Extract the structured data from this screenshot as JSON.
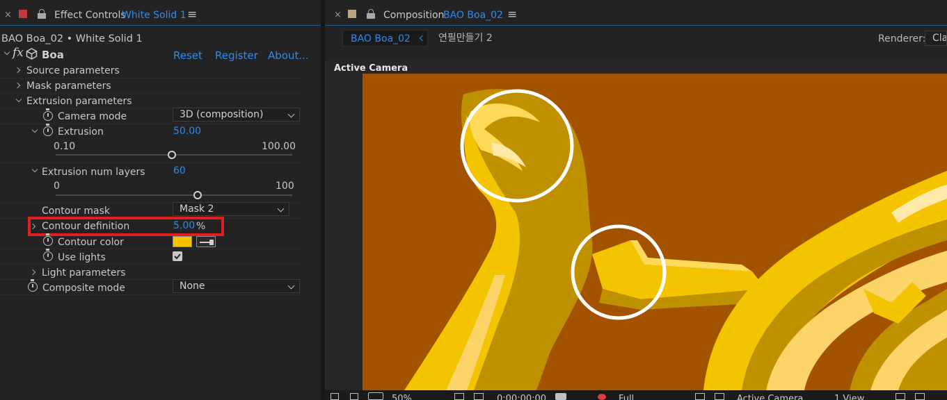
{
  "effect_controls": {
    "close_glyph": "×",
    "title": "Effect Controls",
    "layer_name": "White Solid 1",
    "menu_glyph": "≡",
    "breadcrumb": "BAO Boa_02 • White Solid 1",
    "effect": {
      "fx_label": "fx",
      "name": "Boa",
      "reset": "Reset",
      "register": "Register",
      "about": "About..."
    },
    "groups": {
      "source": "Source parameters",
      "mask": "Mask parameters",
      "extrusion": "Extrusion parameters",
      "light": "Light parameters"
    },
    "camera_mode": {
      "label": "Camera mode",
      "value": "3D (composition)"
    },
    "extrusion": {
      "label": "Extrusion",
      "value": "50.00",
      "min": "0.10",
      "max": "100.00",
      "fraction": 0.5
    },
    "extrusion_layers": {
      "label": "Extrusion num layers",
      "value": "60",
      "min": "0",
      "max": "100",
      "fraction": 0.6
    },
    "contour_mask": {
      "label": "Contour mask",
      "value": "Mask 2"
    },
    "contour_definition": {
      "label": "Contour definition",
      "value": "5.00",
      "unit": "%"
    },
    "contour_color": {
      "label": "Contour color",
      "swatch": "#f5c400"
    },
    "use_lights": {
      "label": "Use lights",
      "checked": true
    },
    "composite_mode": {
      "label": "Composite mode",
      "value": "None"
    },
    "highlight_color": "#e0201f"
  },
  "composition": {
    "close_glyph": "×",
    "title": "Composition",
    "comp_name": "BAO Boa_02",
    "menu_glyph": "≡",
    "tab_active": "BAO Boa_02",
    "tab_other": "연필만들기 2",
    "renderer_label": "Renderer:",
    "renderer_value": "Cla",
    "viewer_label": "Active Camera",
    "bottom": {
      "zoom": "50%",
      "timecode": "0:00:00:00",
      "resolution": "Full",
      "camera": "Active Camera",
      "views": "1 View"
    },
    "background_color": "#a35200",
    "tube_color": "#f5c400"
  }
}
